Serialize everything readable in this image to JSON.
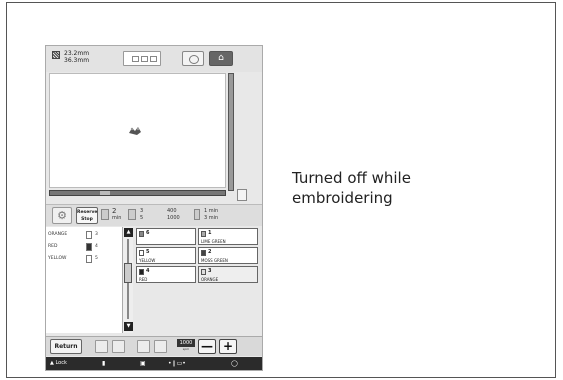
{
  "caption": {
    "line1": "Turned off while",
    "line2": "embroidering"
  },
  "top": {
    "size_width": "23.2mm",
    "size_height": "36.3mm"
  },
  "progress": {
    "reserve_stop_line1": "Reserve",
    "reserve_stop_line2": "Stop",
    "color_count_current": "2",
    "color_count_unit": "min",
    "color_index": "3",
    "color_total": "5",
    "stitch_current": "400",
    "stitch_total": "1000",
    "time_current": "1 min",
    "time_total": "3 min"
  },
  "thread_list": [
    {
      "name": "ORANGE",
      "num": "3",
      "color": "#ffffff"
    },
    {
      "name": "RED",
      "num": "4",
      "color": "#333333"
    },
    {
      "name": "YELLOW",
      "num": "5",
      "color": "#ffffff"
    }
  ],
  "color_grid": [
    {
      "num": "6",
      "name": "",
      "color": "#888888"
    },
    {
      "num": "1",
      "name": "LIME GREEN",
      "color": "#aaaaaa"
    },
    {
      "num": "5",
      "name": "YELLOW",
      "color": "#ffffff"
    },
    {
      "num": "2",
      "name": "MOSS GREEN",
      "color": "#444444"
    },
    {
      "num": "4",
      "name": "RED",
      "color": "#222222"
    },
    {
      "num": "3",
      "name": "ORANGE",
      "color": "#dddddd"
    }
  ],
  "bottom": {
    "return_label": "Return",
    "speed_value": "1000",
    "speed_unit": "spm",
    "minus": "—",
    "plus": "+"
  },
  "status": {
    "lock_label": "Lock"
  }
}
